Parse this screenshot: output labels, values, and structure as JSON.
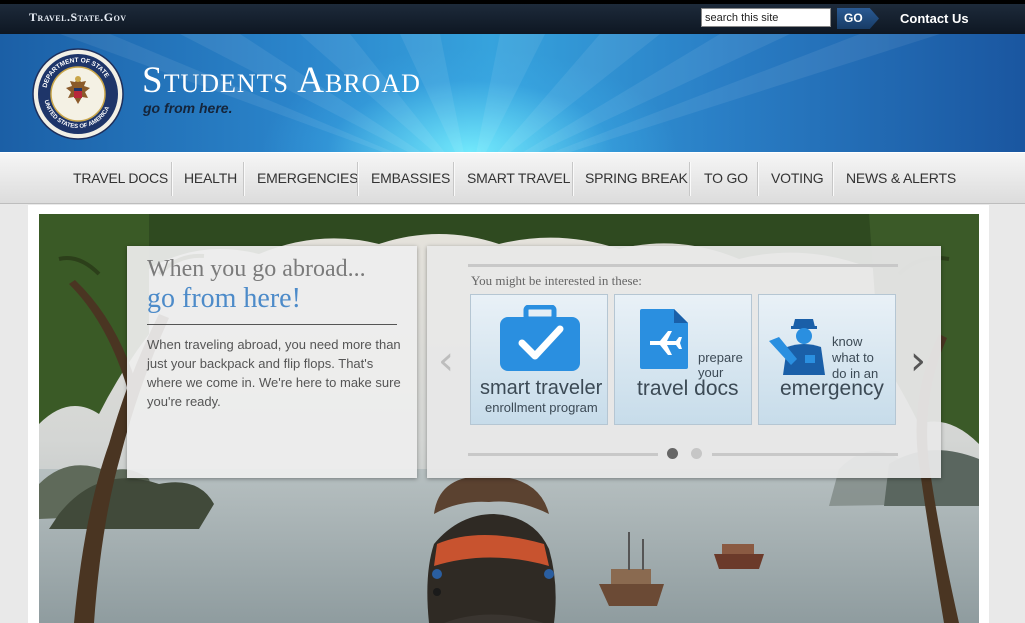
{
  "topbar": {
    "site_link": "Travel.State.Gov",
    "search_placeholder": "search this site",
    "go_label": "GO",
    "contact_label": "Contact Us"
  },
  "banner": {
    "seal_text_top": "DEPARTMENT OF STATE",
    "seal_text_bottom": "UNITED STATES OF AMERICA",
    "title": "Students Abroad",
    "tagline": "go from here."
  },
  "nav": {
    "items": [
      "TRAVEL DOCS",
      "HEALTH",
      "EMERGENCIES",
      "EMBASSIES",
      "SMART TRAVEL",
      "SPRING BREAK",
      "TO GO",
      "VOTING",
      "NEWS & ALERTS"
    ]
  },
  "hero": {
    "headline_1": "When you go abroad...",
    "headline_2": "go from here!",
    "body": "When traveling abroad, you need more than just your backpack and flip flops. That's where we come in. We're here to make sure you're ready."
  },
  "interests": {
    "label": "You might be interested in these:",
    "prev_arrow": "‹",
    "next_arrow": "›",
    "cards": [
      {
        "icon": "briefcase-check-icon",
        "line1": "smart traveler",
        "line2": "enrollment program"
      },
      {
        "icon": "document-plane-icon",
        "small": "prepare your",
        "big": "travel docs"
      },
      {
        "icon": "officer-icon",
        "small": "know what to do in an",
        "big": "emergency"
      }
    ],
    "pages": 2,
    "active_page": 1
  },
  "colors": {
    "accent_blue": "#4d8bc9",
    "icon_blue": "#2a8fe0",
    "topbar": "#0e1723"
  }
}
